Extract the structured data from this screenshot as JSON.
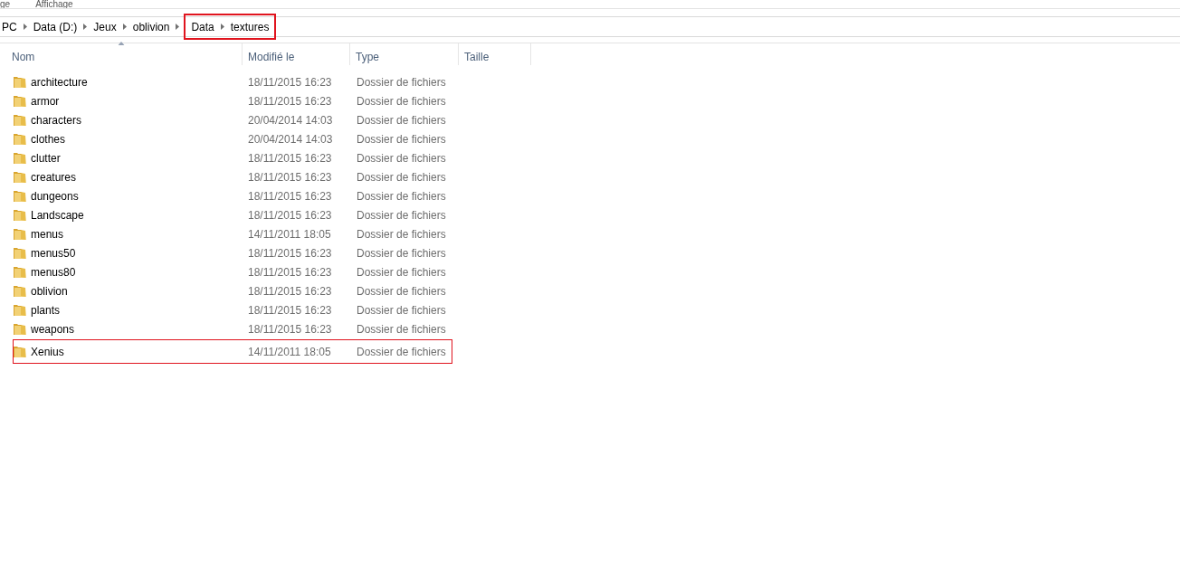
{
  "ribbon_tabs": [
    "ge",
    "Affichage"
  ],
  "breadcrumb": [
    {
      "label": "PC",
      "highlighted": false
    },
    {
      "label": "Data (D:)",
      "highlighted": false
    },
    {
      "label": "Jeux",
      "highlighted": false
    },
    {
      "label": "oblivion",
      "highlighted": false
    },
    {
      "label": "Data",
      "highlighted": true
    },
    {
      "label": "textures",
      "highlighted": true
    }
  ],
  "columns": [
    {
      "label": "Nom",
      "sorted": true
    },
    {
      "label": "Modifié le",
      "sorted": false
    },
    {
      "label": "Type",
      "sorted": false
    },
    {
      "label": "Taille",
      "sorted": false
    }
  ],
  "rows": [
    {
      "name": "architecture",
      "modified": "18/11/2015 16:23",
      "type": "Dossier de fichiers",
      "highlighted": false
    },
    {
      "name": "armor",
      "modified": "18/11/2015 16:23",
      "type": "Dossier de fichiers",
      "highlighted": false
    },
    {
      "name": "characters",
      "modified": "20/04/2014 14:03",
      "type": "Dossier de fichiers",
      "highlighted": false
    },
    {
      "name": "clothes",
      "modified": "20/04/2014 14:03",
      "type": "Dossier de fichiers",
      "highlighted": false
    },
    {
      "name": "clutter",
      "modified": "18/11/2015 16:23",
      "type": "Dossier de fichiers",
      "highlighted": false
    },
    {
      "name": "creatures",
      "modified": "18/11/2015 16:23",
      "type": "Dossier de fichiers",
      "highlighted": false
    },
    {
      "name": "dungeons",
      "modified": "18/11/2015 16:23",
      "type": "Dossier de fichiers",
      "highlighted": false
    },
    {
      "name": "Landscape",
      "modified": "18/11/2015 16:23",
      "type": "Dossier de fichiers",
      "highlighted": false
    },
    {
      "name": "menus",
      "modified": "14/11/2011 18:05",
      "type": "Dossier de fichiers",
      "highlighted": false
    },
    {
      "name": "menus50",
      "modified": "18/11/2015 16:23",
      "type": "Dossier de fichiers",
      "highlighted": false
    },
    {
      "name": "menus80",
      "modified": "18/11/2015 16:23",
      "type": "Dossier de fichiers",
      "highlighted": false
    },
    {
      "name": "oblivion",
      "modified": "18/11/2015 16:23",
      "type": "Dossier de fichiers",
      "highlighted": false
    },
    {
      "name": "plants",
      "modified": "18/11/2015 16:23",
      "type": "Dossier de fichiers",
      "highlighted": false
    },
    {
      "name": "weapons",
      "modified": "18/11/2015 16:23",
      "type": "Dossier de fichiers",
      "highlighted": false
    },
    {
      "name": "Xenius",
      "modified": "14/11/2011 18:05",
      "type": "Dossier de fichiers",
      "highlighted": true
    }
  ]
}
